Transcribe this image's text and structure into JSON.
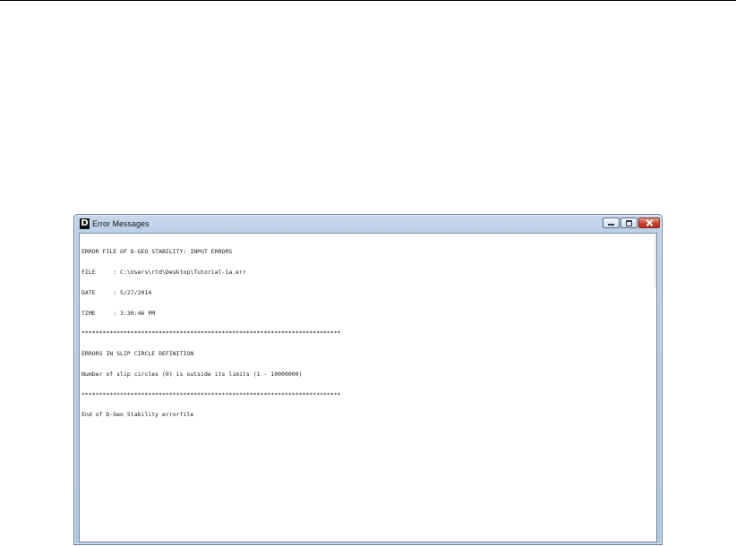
{
  "window": {
    "title": "Error Messages",
    "icon_letter": "D",
    "icon": "app-d-icon"
  },
  "controls": {
    "minimize": "minimize-icon",
    "maximize": "maximize-icon",
    "close": "close-icon"
  },
  "error_file": {
    "lines": [
      "ERROR FILE OF D-GEO STABILITY: INPUT ERRORS",
      "FILE     : C:\\Users\\rtd\\Desktop\\Tutorial-1a.err",
      "DATE     : 5/27/2014",
      "TIME     : 3:30:46 PM",
      "**************************************************************************",
      "ERRORS IN SLIP CIRCLE DEFINITION",
      "Number of slip circles (0) is outside its limits (1 - 10000000)",
      "**************************************************************************",
      "End of D-Geo Stability errorfile"
    ]
  },
  "colors": {
    "title_bar": "#bcd0e7",
    "close_button": "#c8412f",
    "text": "#222222"
  }
}
